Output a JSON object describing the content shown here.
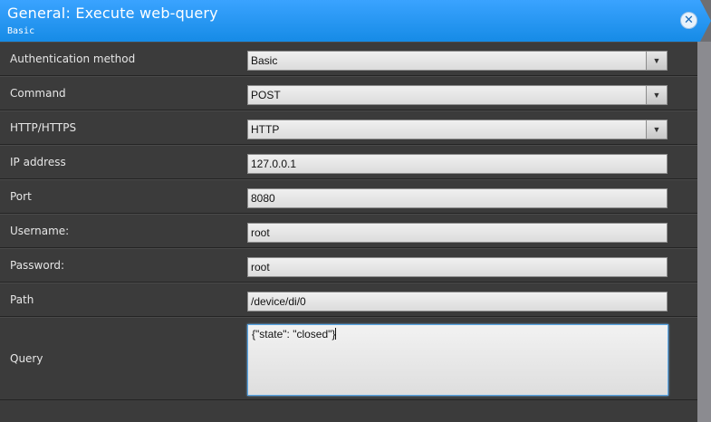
{
  "dialog": {
    "title": "General: Execute web-query",
    "subtitle": "Basic",
    "close_icon": "✕"
  },
  "rows": [
    {
      "label": "Authentication method",
      "type": "select",
      "value": "Basic"
    },
    {
      "label": "Command",
      "type": "select",
      "value": "POST"
    },
    {
      "label": "HTTP/HTTPS",
      "type": "select",
      "value": "HTTP"
    },
    {
      "label": "IP address",
      "type": "input",
      "value": "127.0.0.1"
    },
    {
      "label": "Port",
      "type": "input",
      "value": "8080"
    },
    {
      "label": "Username:",
      "type": "input",
      "value": "root"
    },
    {
      "label": "Password:",
      "type": "input",
      "value": "root"
    },
    {
      "label": "Path",
      "type": "input",
      "value": "/device/di/0"
    },
    {
      "label": "Query",
      "type": "textarea",
      "value": "{\"state\": \"closed\"}"
    }
  ],
  "icons": {
    "dropdown_arrow": "▼"
  },
  "colors": {
    "header": "#168be6",
    "panel": "#3b3b3b"
  }
}
